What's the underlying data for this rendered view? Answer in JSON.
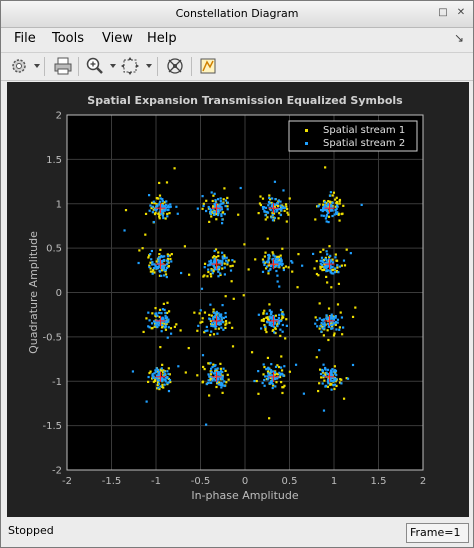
{
  "window": {
    "title": "Constellation Diagram"
  },
  "menu": {
    "file": "File",
    "tools": "Tools",
    "view": "View",
    "help": "Help"
  },
  "icons": {
    "settings": "gear-icon",
    "print": "printer-icon",
    "zoom": "zoom-in-icon",
    "autoscale": "autoscale-icon",
    "reference": "constellation-reference-icon",
    "measurements": "measurements-icon",
    "dock": "dock-arrow-icon",
    "maximize": "maximize-icon",
    "close": "close-icon"
  },
  "status": {
    "state": "Stopped",
    "frame": "Frame=1"
  },
  "chart_data": {
    "type": "scatter",
    "title": "Spatial Expansion Transmission Equalized Symbols",
    "xlabel": "In-phase Amplitude",
    "ylabel": "Quadrature Amplitude",
    "xlim": [
      -2,
      2
    ],
    "ylim": [
      -2,
      2
    ],
    "xticks": [
      -2,
      -1.5,
      -1,
      -0.5,
      0,
      0.5,
      1,
      1.5,
      2
    ],
    "yticks": [
      -2,
      -1.5,
      -1,
      -0.5,
      0,
      0.5,
      1,
      1.5,
      2
    ],
    "grid": true,
    "legend_position": "top-right",
    "reference_points": {
      "levels": [
        -0.95,
        -0.32,
        0.32,
        0.95
      ],
      "color": "#ff2020"
    },
    "series": [
      {
        "name": "Spatial stream 1",
        "color": "#f0e000",
        "spread": 0.075,
        "points_per_cluster": 40
      },
      {
        "name": "Spatial stream 2",
        "color": "#1fa0ff",
        "spread": 0.055,
        "points_per_cluster": 55
      }
    ]
  }
}
